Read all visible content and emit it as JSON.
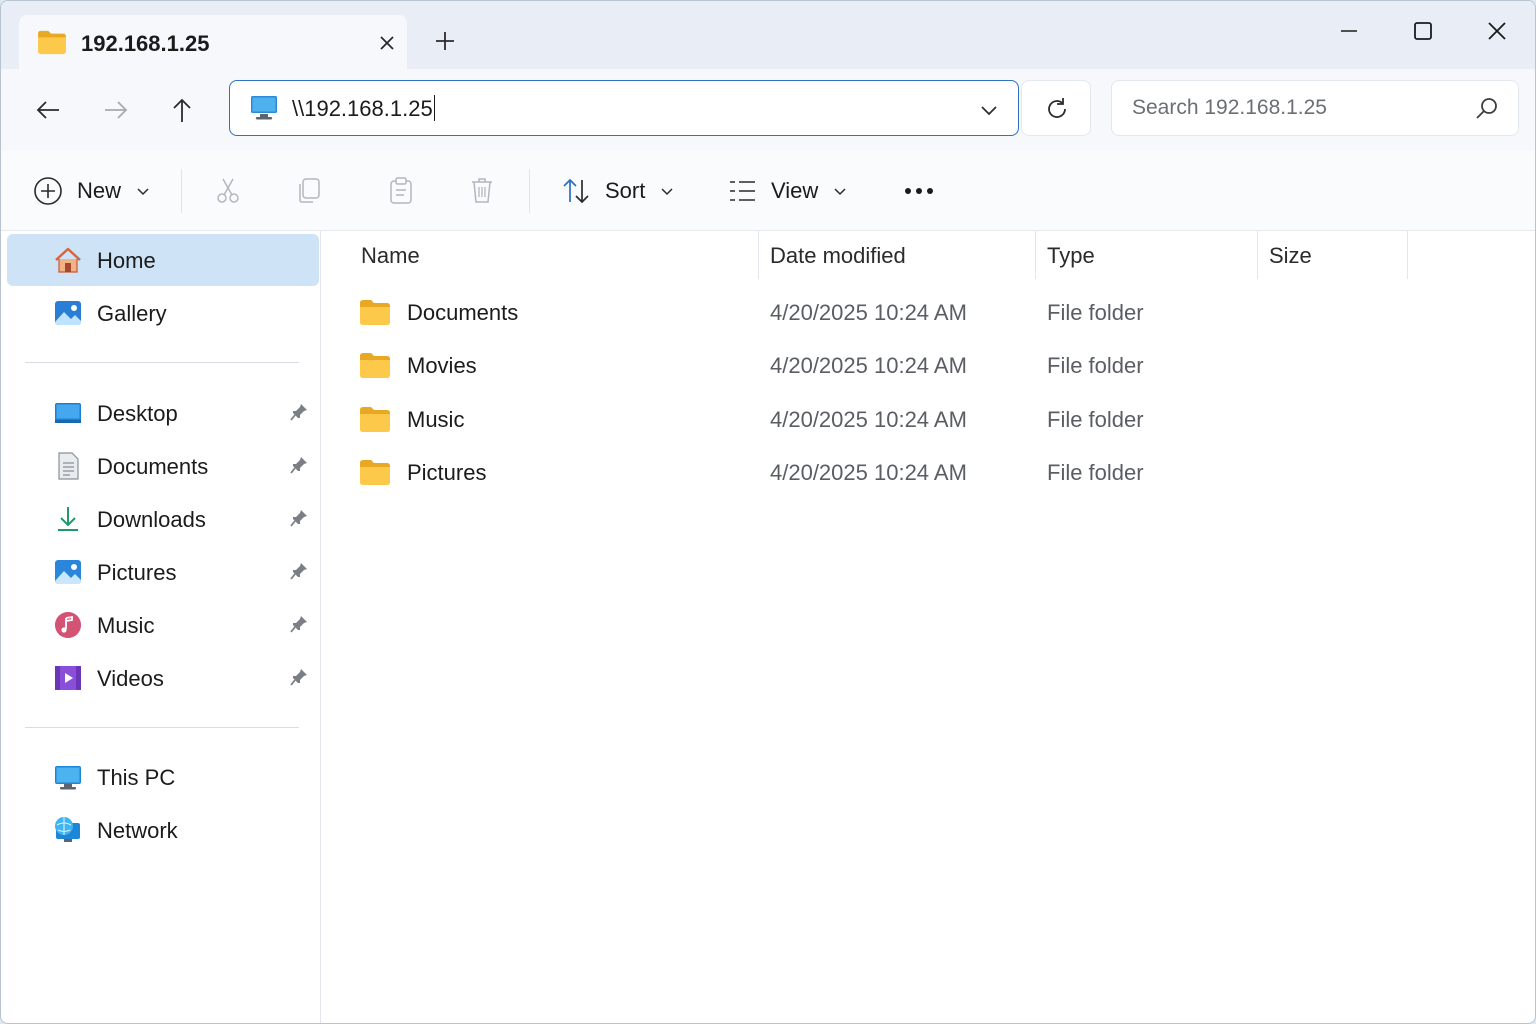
{
  "tab": {
    "title": "192.168.1.25"
  },
  "address": {
    "value": "\\\\192.168.1.25"
  },
  "search": {
    "placeholder": "Search 192.168.1.25"
  },
  "toolbar": {
    "new_label": "New",
    "sort_label": "Sort",
    "view_label": "View"
  },
  "sidebar": {
    "items": [
      {
        "label": "Home",
        "icon": "home-icon",
        "selected": true
      },
      {
        "label": "Gallery",
        "icon": "gallery-icon"
      },
      {
        "label": "Desktop",
        "icon": "desktop-icon",
        "pinned": true
      },
      {
        "label": "Documents",
        "icon": "documents-icon",
        "pinned": true
      },
      {
        "label": "Downloads",
        "icon": "downloads-icon",
        "pinned": true
      },
      {
        "label": "Pictures",
        "icon": "pictures-icon",
        "pinned": true
      },
      {
        "label": "Music",
        "icon": "music-icon",
        "pinned": true
      },
      {
        "label": "Videos",
        "icon": "videos-icon",
        "pinned": true
      },
      {
        "label": "This PC",
        "icon": "this-pc-icon"
      },
      {
        "label": "Network",
        "icon": "network-icon"
      }
    ]
  },
  "columns": {
    "name": "Name",
    "date": "Date modified",
    "type": "Type",
    "size": "Size"
  },
  "files": [
    {
      "name": "Documents",
      "date": "4/20/2025 10:24 AM",
      "type": "File folder"
    },
    {
      "name": "Movies",
      "date": "4/20/2025 10:24 AM",
      "type": "File folder"
    },
    {
      "name": "Music",
      "date": "4/20/2025 10:24 AM",
      "type": "File folder"
    },
    {
      "name": "Pictures",
      "date": "4/20/2025 10:24 AM",
      "type": "File folder"
    }
  ],
  "colors": {
    "accent": "#2f6fc4",
    "selection": "#cfe3f7",
    "folder": "#f8c544"
  }
}
